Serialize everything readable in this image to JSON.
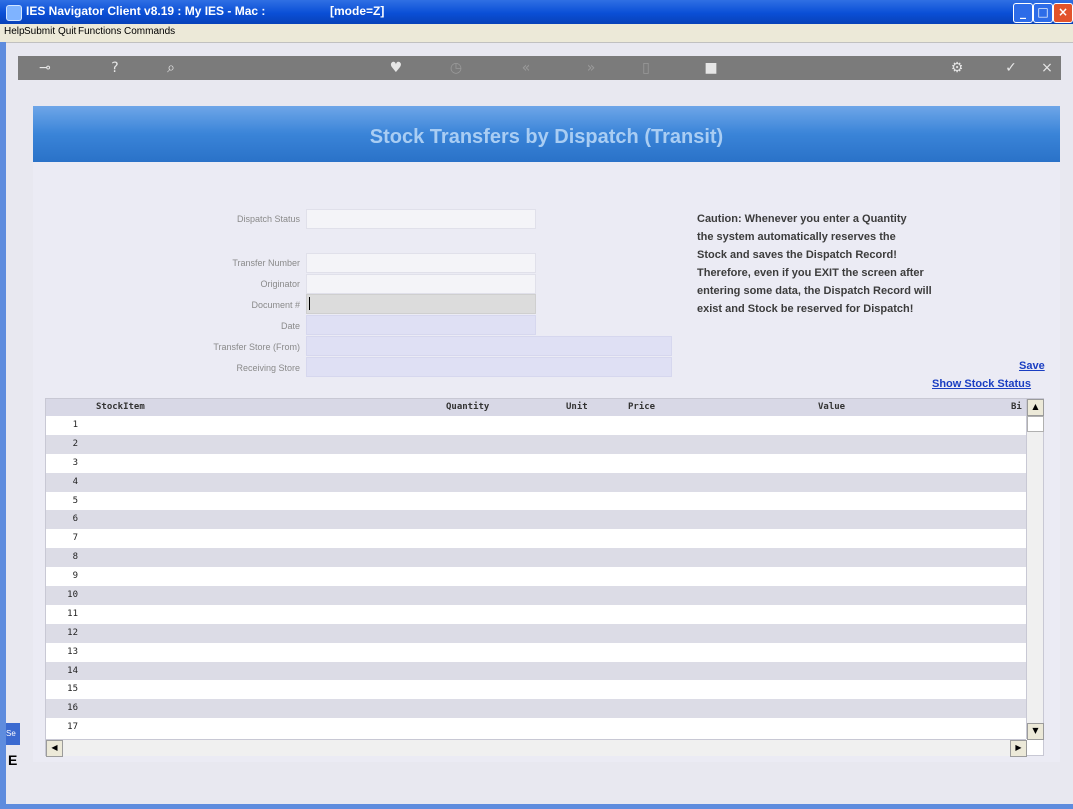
{
  "window": {
    "title": "IES Navigator Client v8.19 : My IES - Mac :",
    "mode": "[mode=Z]"
  },
  "menu": [
    "Help",
    "Submit",
    "Quit",
    "Functions",
    "Commands"
  ],
  "toolbar": {
    "icons": [
      "key-icon",
      "help-icon",
      "search-icon",
      "heart-icon",
      "clock-icon",
      "back-icon",
      "forward-icon",
      "page-icon",
      "square-icon",
      "settings-icon",
      "check-icon",
      "close-icon"
    ]
  },
  "banner": {
    "title": "Stock Transfers by Dispatch (Transit)"
  },
  "form": {
    "dispatch_status": {
      "label": "Dispatch Status",
      "value": ""
    },
    "transfer_number": {
      "label": "Transfer Number",
      "value": ""
    },
    "originator": {
      "label": "Originator",
      "value": ""
    },
    "document": {
      "label": "Document #",
      "value": ""
    },
    "date": {
      "label": "Date",
      "value": ""
    },
    "transfer_store": {
      "label": "Transfer Store (From)",
      "value": ""
    },
    "receiving_store": {
      "label": "Receiving Store",
      "value": ""
    }
  },
  "caution": {
    "lines": [
      "Caution: Whenever you enter a Quantity",
      "the system automatically reserves the",
      "Stock and saves the Dispatch Record!",
      "Therefore, even if you EXIT the screen after",
      "entering some data, the Dispatch Record will",
      "exist and Stock be reserved for Dispatch!"
    ]
  },
  "links": {
    "save": "Save",
    "show_stock_status": "Show Stock Status"
  },
  "grid": {
    "columns": [
      "StockItem",
      "Quantity",
      "Unit",
      "Price",
      "Value",
      "Bi"
    ],
    "rows": [
      "1",
      "2",
      "3",
      "4",
      "5",
      "6",
      "7",
      "8",
      "9",
      "10",
      "11",
      "12",
      "13",
      "14",
      "15",
      "16",
      "17"
    ]
  },
  "side": {
    "tab": "Se",
    "letter": "E"
  }
}
